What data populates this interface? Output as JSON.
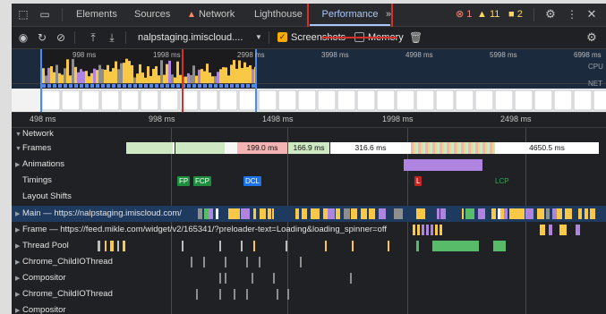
{
  "tabs": [
    {
      "label": "Elements"
    },
    {
      "label": "Sources"
    },
    {
      "label": "Network"
    },
    {
      "label": "Lighthouse"
    },
    {
      "label": "Performance",
      "active": true
    }
  ],
  "more_tabs": "»",
  "status": {
    "errors": "1",
    "warnings": "11",
    "issues": "2"
  },
  "toolbar": {
    "url": "nalpstaging.imiscloud....",
    "screenshots_label": "Screenshots",
    "screenshots_checked": true,
    "memory_label": "Memory",
    "memory_checked": false
  },
  "overview": {
    "ticks": [
      "998 ms",
      "1998 ms",
      "2998 ms",
      "3998 ms",
      "4998 ms",
      "5998 ms",
      "6998 ms"
    ],
    "cpu_label": "CPU",
    "net_label": "NET"
  },
  "ruler": {
    "ticks": [
      "498 ms",
      "998 ms",
      "1498 ms",
      "1998 ms",
      "2498 ms"
    ]
  },
  "tracks": {
    "network": "Network",
    "frames": "Frames",
    "animations": "Animations",
    "timings": "Timings",
    "layout_shifts": "Layout Shifts",
    "main": "Main — https://nalpstaging.imiscloud.com/",
    "frame": "Frame — https://feed.mikle.com/widget/v2/165341/?preloader-text=Loading&loading_spinner=off",
    "thread_pool": "Thread Pool",
    "child_io_1": "Chrome_ChildIOThread",
    "compositor_1": "Compositor",
    "child_io_2": "Chrome_ChildIOThread",
    "compositor_2": "Compositor"
  },
  "frames": [
    "199.0 ms",
    "166.9 ms",
    "316.6 ms",
    "4650.5 ms"
  ],
  "timings": {
    "fp": "FP",
    "fcp": "FCP",
    "dcl": "DCL",
    "l": "L",
    "lcp": "LCP"
  },
  "colors": {
    "background": "#202124",
    "accent": "#a8c7fa",
    "frames_green": "#cde8c3",
    "frames_red": "#f4b4b4",
    "scripting": "#f9c846",
    "rendering": "#af84e0",
    "painting": "#57bb6a",
    "fp": "#1e8e3e",
    "dcl": "#1a73e8",
    "load": "#c5221f"
  }
}
